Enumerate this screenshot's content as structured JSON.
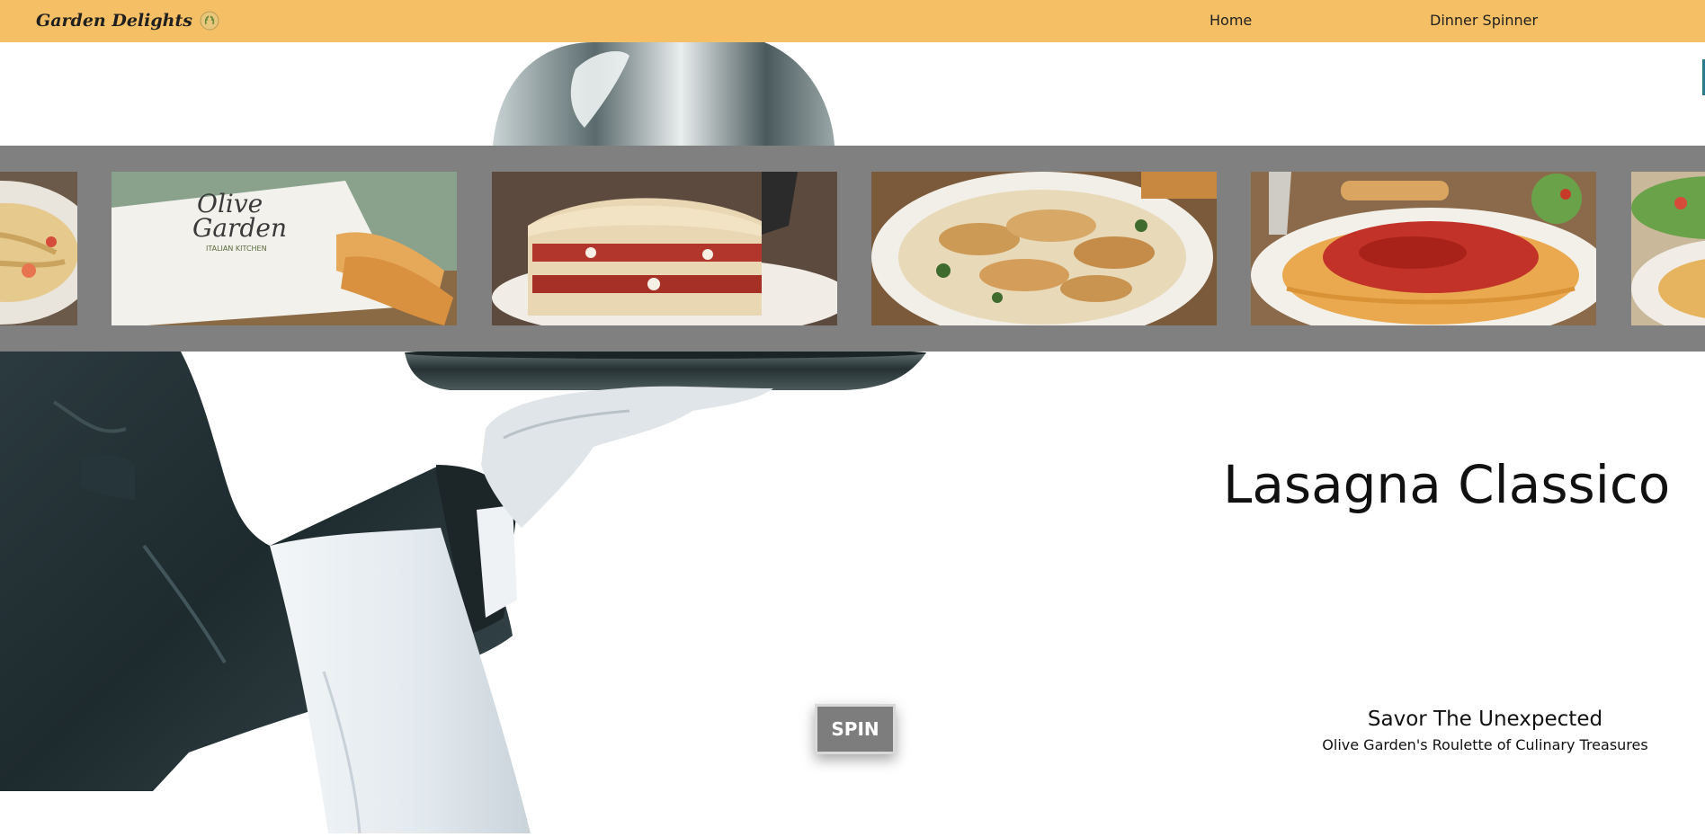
{
  "navbar": {
    "brand": "Garden Delights",
    "brand_icon": "laurel-icon",
    "links": [
      {
        "label": "Home"
      },
      {
        "label": "Dinner Spinner"
      }
    ]
  },
  "carousel": {
    "items": [
      {
        "name": "pasta-shrimp-partial"
      },
      {
        "name": "olive-garden-breadsticks",
        "logo_text": "Olive Garden",
        "logo_sub": "ITALIAN KITCHEN"
      },
      {
        "name": "lasagna"
      },
      {
        "name": "chicken-fettuccine"
      },
      {
        "name": "spaghetti-meat-sauce"
      },
      {
        "name": "salad-partial"
      }
    ]
  },
  "selected_dish": "Lasagna Classico",
  "spin_button": "SPIN",
  "tagline": {
    "title": "Savor The Unexpected",
    "subtitle": "Olive Garden's Roulette of Culinary Treasures"
  },
  "colors": {
    "navbar": "#f5bf65",
    "carousel_bg": "#808080",
    "spin_button": "#7d7d7d"
  }
}
